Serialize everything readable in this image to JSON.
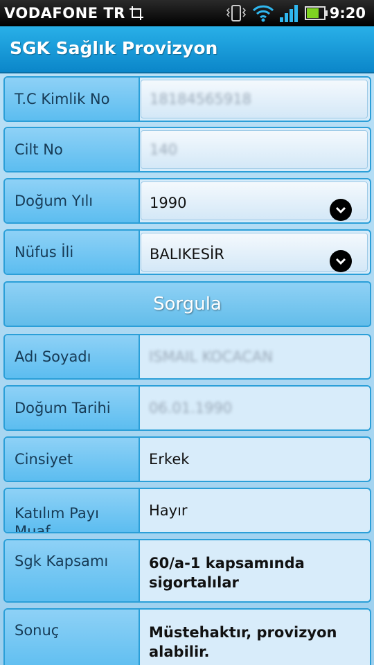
{
  "status_bar": {
    "carrier": "VODAFONE TR",
    "time": "9:20",
    "icons": [
      "screenshot-icon",
      "vibrate-icon",
      "wifi-icon",
      "signal-icon",
      "battery-icon"
    ]
  },
  "app": {
    "title": "SGK Sağlık Provizyon"
  },
  "form": {
    "tc_kimlik_label": "T.C Kimlik No",
    "tc_kimlik_value": "18184565918",
    "cilt_label": "Cilt No",
    "cilt_value": "140",
    "dogum_yili_label": "Doğum Yılı",
    "dogum_yili_value": "1990",
    "nufus_ili_label": "Nüfus İli",
    "nufus_ili_value": "BALIKESİR"
  },
  "query_button_label": "Sorgula",
  "results": {
    "adi_soyadi_label": "Adı Soyadı",
    "adi_soyadi_value": "ISMAIL KOCACAN",
    "dogum_tarihi_label": "Doğum Tarihi",
    "dogum_tarihi_value": "06.01.1990",
    "cinsiyet_label": "Cinsiyet",
    "cinsiyet_value": "Erkek",
    "katilim_payi_label": "Katılım Payı Muaf",
    "katilim_payi_value": "Hayır",
    "sgk_kapsami_label": "Sgk Kapsamı",
    "sgk_kapsami_value": "60/a-1 kapsamında sigortalılar",
    "sonuc_label": "Sonuç",
    "sonuc_value": "Müstehaktır, provizyon alabilir."
  },
  "colors": {
    "title_bar": "#1a9ddb",
    "label_bg": "#6cc3f2",
    "border": "#2b9fd8",
    "background": "#a9d6f1"
  }
}
